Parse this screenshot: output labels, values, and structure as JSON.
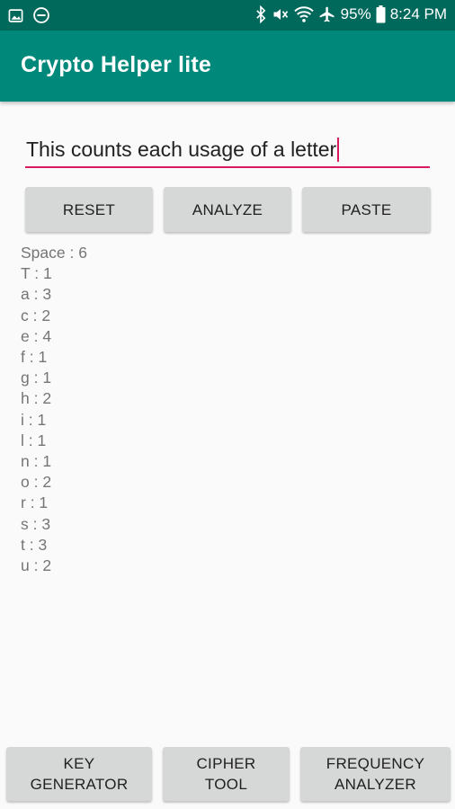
{
  "status_bar": {
    "battery": "95%",
    "time": "8:24 PM"
  },
  "app_bar": {
    "title": "Crypto Helper lite"
  },
  "input": {
    "value": "This counts each usage of a letter"
  },
  "buttons": {
    "reset": "RESET",
    "analyze": "ANALYZE",
    "paste": "PASTE"
  },
  "results": [
    "Space : 6",
    "T : 1",
    "a : 3",
    "c : 2",
    "e : 4",
    "f : 1",
    "g : 1",
    "h : 2",
    "i : 1",
    "l : 1",
    "n : 1",
    "o : 2",
    "r : 1",
    "s : 3",
    "t : 3",
    "u : 2"
  ],
  "bottom_nav": {
    "key_generator_line1": "KEY",
    "key_generator_line2": "GENERATOR",
    "cipher_tool_line1": "CIPHER",
    "cipher_tool_line2": "TOOL",
    "frequency_analyzer_line1": "FREQUENCY",
    "frequency_analyzer_line2": "ANALYZER"
  },
  "colors": {
    "status_bar": "#00695c",
    "app_bar": "#00897b",
    "accent": "#d81b60",
    "button": "#d6d7d7"
  },
  "icons": {
    "status_left": [
      "image-icon",
      "do-not-disturb-icon"
    ],
    "status_right": [
      "bluetooth-icon",
      "mute-icon",
      "wifi-icon",
      "airplane-icon",
      "battery-icon"
    ]
  }
}
